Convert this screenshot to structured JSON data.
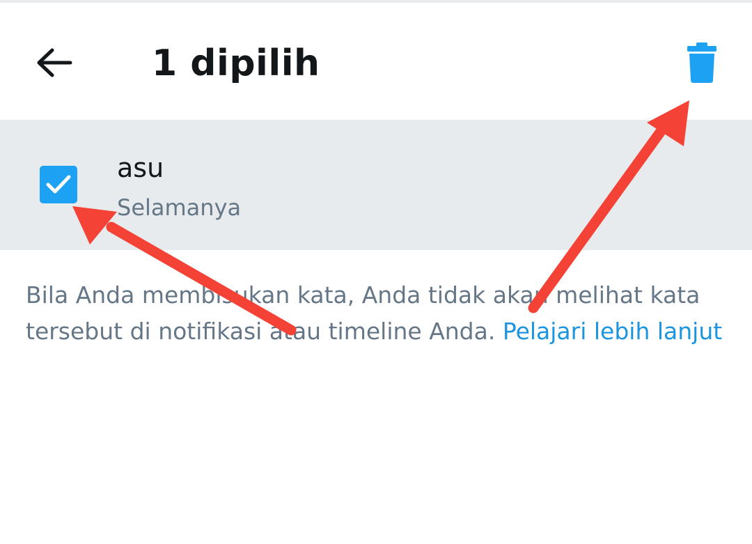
{
  "toolbar": {
    "back_icon": "arrow-left-icon",
    "title": "1 dipilih",
    "delete_icon": "trash-icon"
  },
  "muted_list": {
    "items": [
      {
        "word": "asu",
        "duration": "Selamanya",
        "checked": true
      }
    ]
  },
  "info": {
    "text": "Bila Anda membisukan kata, Anda tidak akan melihat kata tersebut di notifikasi atau timeline Anda.",
    "link_label": "Pelajari lebih lanjut"
  },
  "colors": {
    "accent": "#1da1f2",
    "link": "#1b95e0",
    "selected_row_bg": "#e8ebed",
    "secondary_text": "#657786",
    "annotation_arrow": "#f44336"
  }
}
